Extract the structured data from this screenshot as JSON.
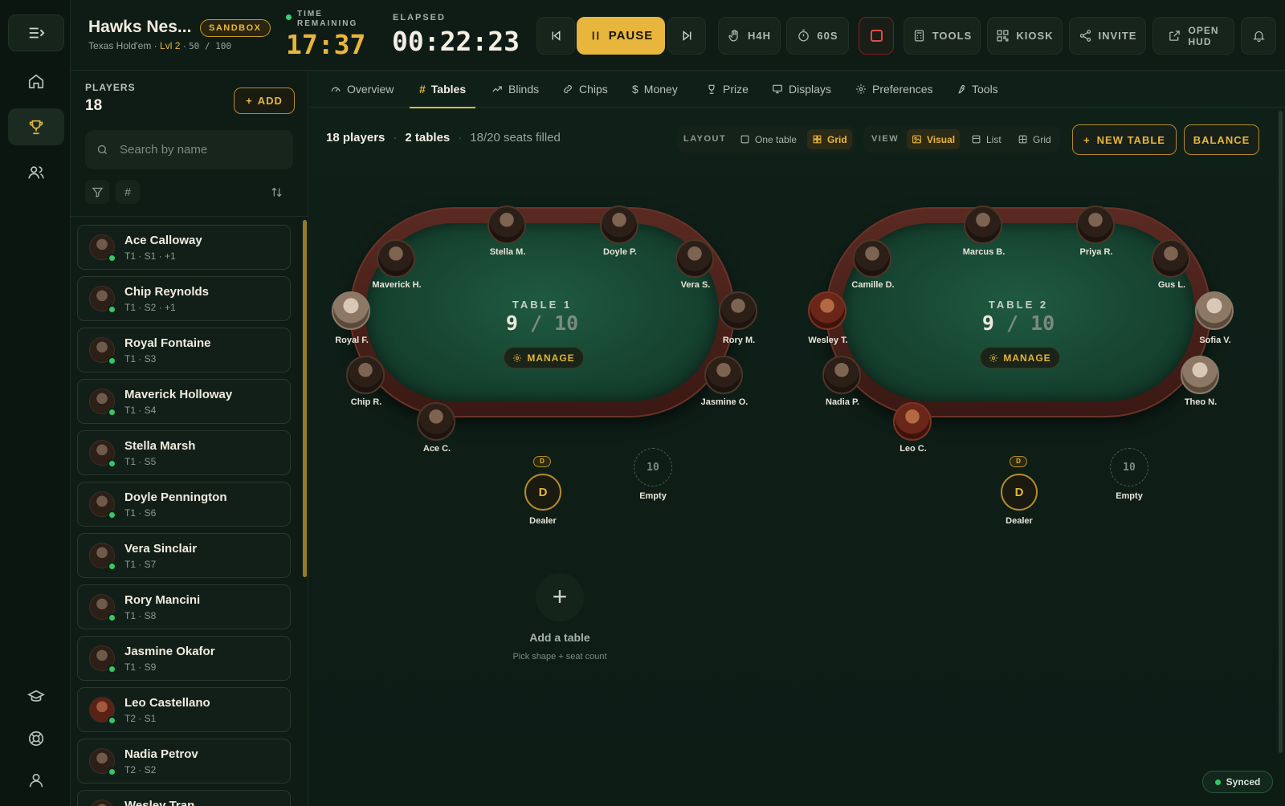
{
  "tournament": {
    "title": "Hawks Nes...",
    "badge": "SANDBOX",
    "game": "Texas Hold'em",
    "level": "Lvl 2",
    "bullet": "·",
    "players_progress": "50 / 100",
    "time_remaining_label": "TIME REMAINING",
    "time_remaining": "17:37",
    "elapsed_label": "ELAPSED",
    "elapsed": "00:22:23"
  },
  "header_buttons": {
    "pause": "PAUSE",
    "h4h": "H4H",
    "timer": "60S",
    "tools": "TOOLS",
    "kiosk": "KIOSK",
    "invite": "INVITE",
    "open_hud_1": "OPEN",
    "open_hud_2": "HUD"
  },
  "players_panel": {
    "label": "PLAYERS",
    "count": "18",
    "add": "ADD",
    "search_placeholder": "Search by name",
    "hash": "#"
  },
  "players": [
    {
      "name": "Ace Calloway",
      "seat": "T1 · S1 · +1"
    },
    {
      "name": "Chip Reynolds",
      "seat": "T1 · S2 · +1"
    },
    {
      "name": "Royal Fontaine",
      "seat": "T1 · S3"
    },
    {
      "name": "Maverick Holloway",
      "seat": "T1 · S4"
    },
    {
      "name": "Stella Marsh",
      "seat": "T1 · S5"
    },
    {
      "name": "Doyle Pennington",
      "seat": "T1 · S6"
    },
    {
      "name": "Vera Sinclair",
      "seat": "T1 · S7"
    },
    {
      "name": "Rory Mancini",
      "seat": "T1 · S8"
    },
    {
      "name": "Jasmine Okafor",
      "seat": "T1 · S9"
    },
    {
      "name": "Leo Castellano",
      "seat": "T2 · S1"
    },
    {
      "name": "Nadia Petrov",
      "seat": "T2 · S2"
    },
    {
      "name": "Wesley Tran",
      "seat": ""
    }
  ],
  "tabs": [
    "Overview",
    "Tables",
    "Blinds",
    "Chips",
    "Money",
    "Prize",
    "Displays",
    "Preferences",
    "Tools"
  ],
  "summary": {
    "players": "18 players",
    "tables": "2 tables",
    "seats": "18/20 seats filled",
    "dot": "·"
  },
  "toolbar": {
    "layout_label": "LAYOUT",
    "one_table": "One table",
    "grid": "Grid",
    "view_label": "VIEW",
    "visual": "Visual",
    "list": "List",
    "view_grid": "Grid",
    "new_table": "NEW TABLE",
    "balance": "BALANCE"
  },
  "tables": [
    {
      "label": "TABLE 1",
      "filled": "9",
      "slash": "/",
      "capacity": "10",
      "manage": "MANAGE",
      "dealer_chip": "D",
      "dealer_button": "D",
      "dealer_label": "Dealer",
      "empty_seat_number": "10",
      "empty_label": "Empty",
      "seats": [
        "Stella M.",
        "Doyle P.",
        "Maverick H.",
        "Vera S.",
        "Royal F.",
        "Rory M.",
        "Chip R.",
        "Jasmine O.",
        "Ace C."
      ]
    },
    {
      "label": "TABLE 2",
      "filled": "9",
      "slash": "/",
      "capacity": "10",
      "manage": "MANAGE",
      "dealer_chip": "D",
      "dealer_button": "D",
      "dealer_label": "Dealer",
      "empty_seat_number": "10",
      "empty_label": "Empty",
      "seats": [
        "Marcus B.",
        "Priya R.",
        "Camille D.",
        "Gus L.",
        "Wesley T.",
        "Sofia V.",
        "Nadia P.",
        "Theo N.",
        "Leo C."
      ]
    }
  ],
  "add_table": {
    "plus": "+",
    "title": "Add a table",
    "subtitle": "Pick shape + seat count"
  },
  "status": {
    "synced": "Synced"
  },
  "colors": {
    "accent": "#e8b63c",
    "background": "#0e1b14",
    "felt": "#174532",
    "online": "#36c765"
  }
}
